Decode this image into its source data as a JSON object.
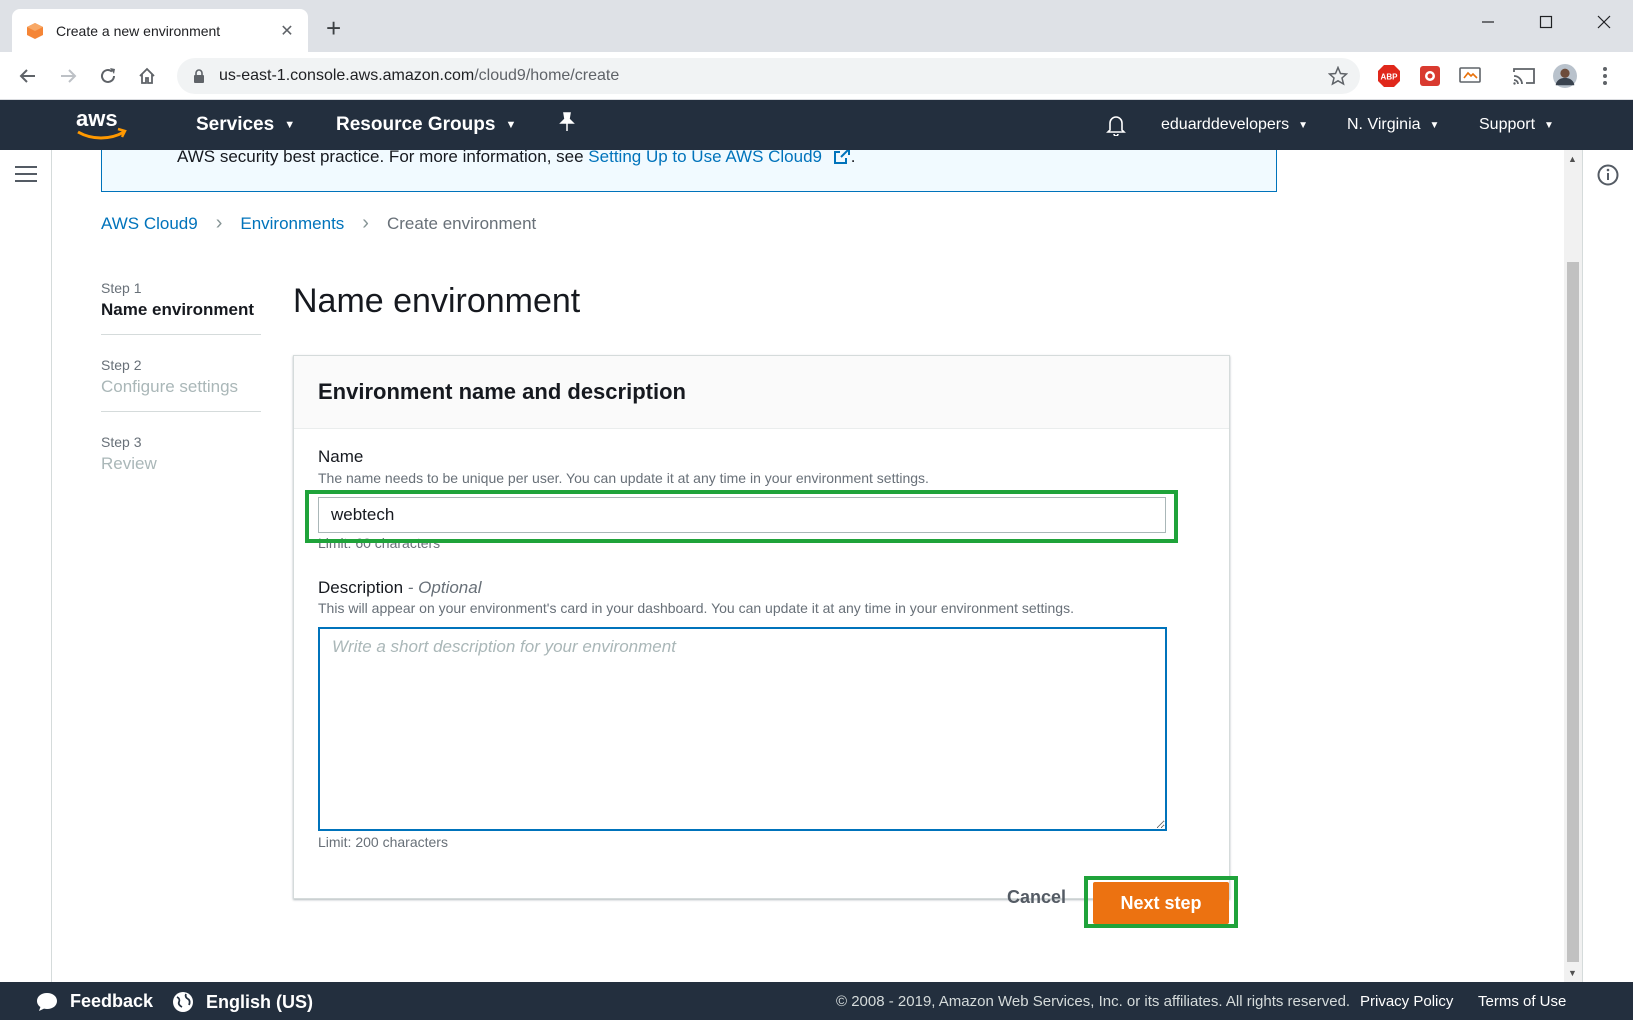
{
  "browser": {
    "tab_title": "Create a new environment",
    "url_host": "us-east-1.console.aws.amazon.com",
    "url_path": "/cloud9/home/create",
    "ext_abp_label": "ABP"
  },
  "nav": {
    "services": "Services",
    "resource_groups": "Resource Groups",
    "account": "eduarddevelopers",
    "region": "N. Virginia",
    "support": "Support"
  },
  "flash": {
    "text": "AWS security best practice. For more information, see ",
    "link": "Setting Up to Use AWS Cloud9",
    "suffix": "."
  },
  "breadcrumb": {
    "items": [
      "AWS Cloud9",
      "Environments"
    ],
    "current": "Create environment"
  },
  "steps": [
    {
      "num": "Step 1",
      "label": "Name environment",
      "active": true
    },
    {
      "num": "Step 2",
      "label": "Configure settings",
      "active": false
    },
    {
      "num": "Step 3",
      "label": "Review",
      "active": false
    }
  ],
  "page_title": "Name environment",
  "panel": {
    "header": "Environment name and description",
    "name_label": "Name",
    "name_hint": "The name needs to be unique per user. You can update it at any time in your environment settings.",
    "name_value": "webtech",
    "name_limit": "Limit: 60 characters",
    "desc_label": "Description",
    "desc_optional": "- Optional",
    "desc_hint": "This will appear on your environment's card in your dashboard. You can update it at any time in your environment settings.",
    "desc_placeholder": "Write a short description for your environment",
    "desc_limit": "Limit: 200 characters"
  },
  "actions": {
    "cancel": "Cancel",
    "next": "Next step"
  },
  "footer": {
    "feedback": "Feedback",
    "language": "English (US)",
    "copyright": "© 2008 - 2019, Amazon Web Services, Inc. or its affiliates. All rights reserved.",
    "privacy": "Privacy Policy",
    "terms": "Terms of Use"
  },
  "colors": {
    "aws_orange": "#ec7211",
    "aws_navy": "#232f3e",
    "link_blue": "#0073bb",
    "highlight_green": "#1fa33a"
  }
}
